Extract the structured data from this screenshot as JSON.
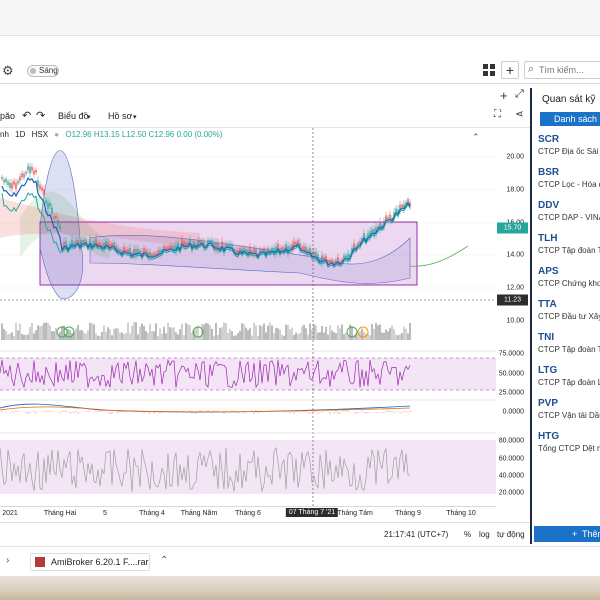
{
  "toolbar": {
    "theme_label": "Sáng",
    "search_placeholder": "Tìm kiếm...",
    "plus_label": "+"
  },
  "chart_toolbar": {
    "truncated_left": "păo",
    "undo": "↶",
    "redo": "↷",
    "chart_menu": "Biểu đồ",
    "profile_menu": "Hồ sơ"
  },
  "legend": {
    "sym_prefix": "nh",
    "interval": "1D",
    "exchange": "HSX",
    "ohlc": "O12.96 H13.15 L12.50 C12.96 0.00 (0.00%)"
  },
  "price_axis": {
    "main_ticks": [
      "20.00",
      "18.00",
      "16.00",
      "14.00",
      "12.00"
    ],
    "current_price": "15.70",
    "crosshair_price": "11.23",
    "volume_tick": "10.00",
    "rsi_ticks": [
      "75.0000",
      "50.0000",
      "25.0000"
    ],
    "macd_tick": "0.0000",
    "osc_ticks": [
      "80.0000",
      "60.0000",
      "40.0000",
      "20.0000"
    ]
  },
  "time_axis": {
    "labels": [
      "2021",
      "Tháng Hai",
      "5",
      "Tháng 4",
      "Tháng Năm",
      "Tháng 6",
      "Tháng Tám",
      "Tháng 9",
      "Tháng 10"
    ],
    "crosshair_date": "07 Tháng 7 '21"
  },
  "bottom_bar": {
    "time": "21:17:41 (UTC+7)",
    "percent": "%",
    "log": "log",
    "auto": "tự động"
  },
  "watchlist": {
    "title": "Quan sát kỹ",
    "list_button": "Danh sách",
    "add_button": "Thêm",
    "items": [
      {
        "symbol": "SCR",
        "name": "CTCP Địa ốc Sài G"
      },
      {
        "symbol": "BSR",
        "name": "CTCP Lọc - Hóa d"
      },
      {
        "symbol": "DDV",
        "name": "CTCP DAP - VINA"
      },
      {
        "symbol": "TLH",
        "name": "CTCP Tập đoàn T"
      },
      {
        "symbol": "APS",
        "name": "CTCP Chứng kho"
      },
      {
        "symbol": "TTA",
        "name": "CTCP Đầu tư Xây"
      },
      {
        "symbol": "TNI",
        "name": "CTCP Tập đoàn T"
      },
      {
        "symbol": "LTG",
        "name": "CTCP Tập đoàn L"
      },
      {
        "symbol": "PVP",
        "name": "CTCP Vận tải Dầu"
      },
      {
        "symbol": "HTG",
        "name": "Tổng CTCP Dệt m"
      }
    ]
  },
  "taskbar": {
    "item_label": "AmiBroker 6.20.1 F....rar"
  },
  "colors": {
    "accent": "#1a73c8",
    "up": "#26a69a",
    "down": "#ef5350",
    "rectangle": "#9c27b0",
    "price_badge": "#26a69a",
    "crosshair_badge": "#2d2d2d"
  }
}
